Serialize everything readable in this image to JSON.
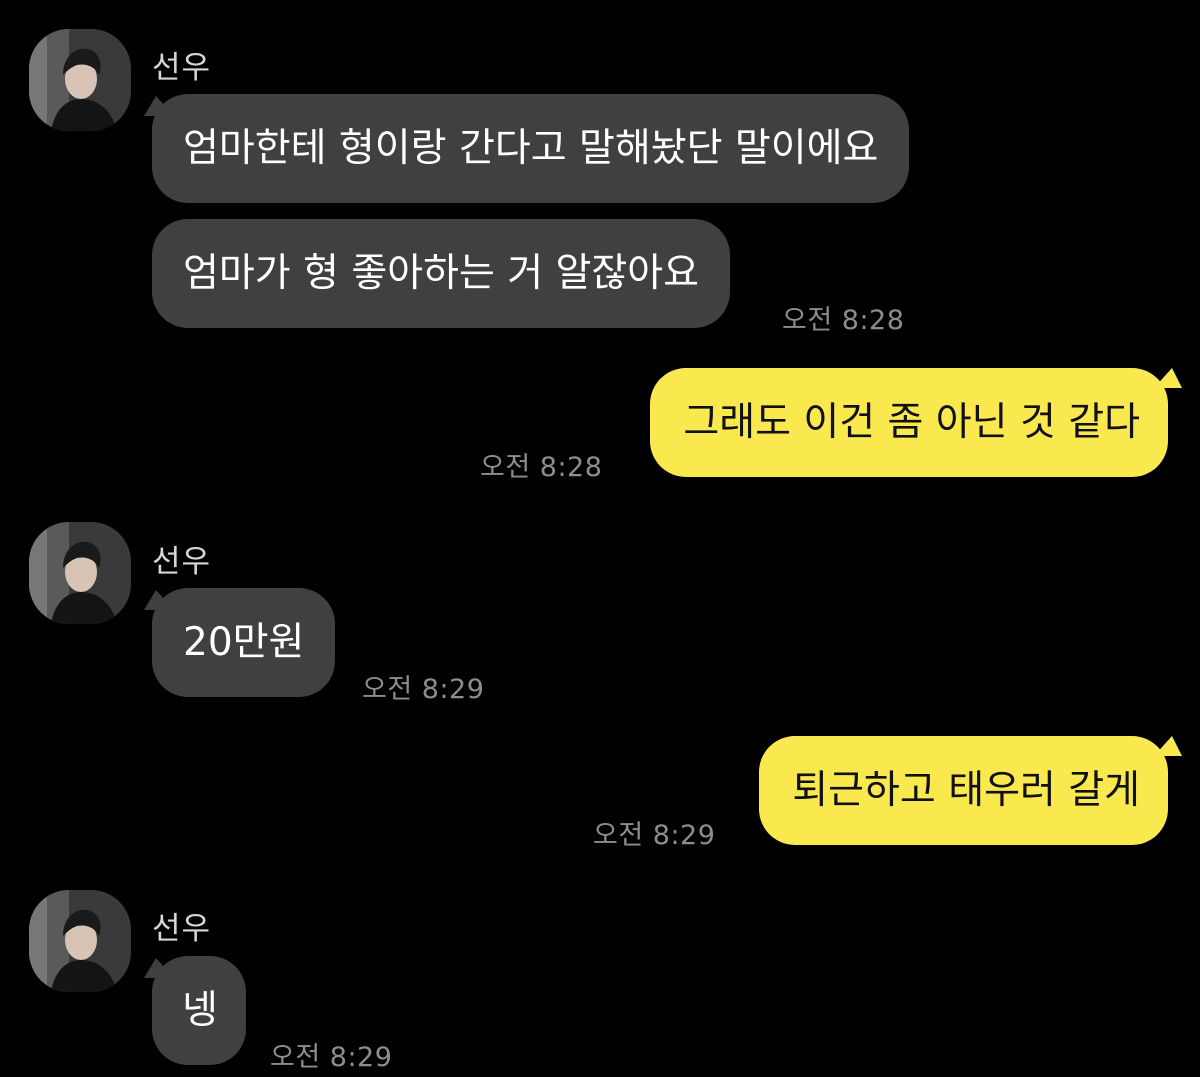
{
  "conversation": {
    "sender_name": "선우",
    "messages": [
      {
        "direction": "incoming",
        "text": "엄마한테 형이랑 간다고 말해놨단 말이에요"
      },
      {
        "direction": "incoming",
        "text": "엄마가 형 좋아하는 거 알잖아요",
        "time": "오전 8:28"
      },
      {
        "direction": "outgoing",
        "text": "그래도 이건 좀 아닌 것 같다",
        "time": "오전 8:28"
      },
      {
        "direction": "incoming",
        "text": "20만원",
        "time": "오전 8:29"
      },
      {
        "direction": "outgoing",
        "text": "퇴근하고 태우러 갈게",
        "time": "오전 8:29"
      },
      {
        "direction": "incoming",
        "text": "넹",
        "time": "오전 8:29"
      }
    ]
  },
  "colors": {
    "background": "#000000",
    "incoming_bubble": "#404040",
    "outgoing_bubble": "#fae84f",
    "timestamp": "#8d8d8d"
  },
  "icons": {
    "avatar": "profile-photo"
  }
}
